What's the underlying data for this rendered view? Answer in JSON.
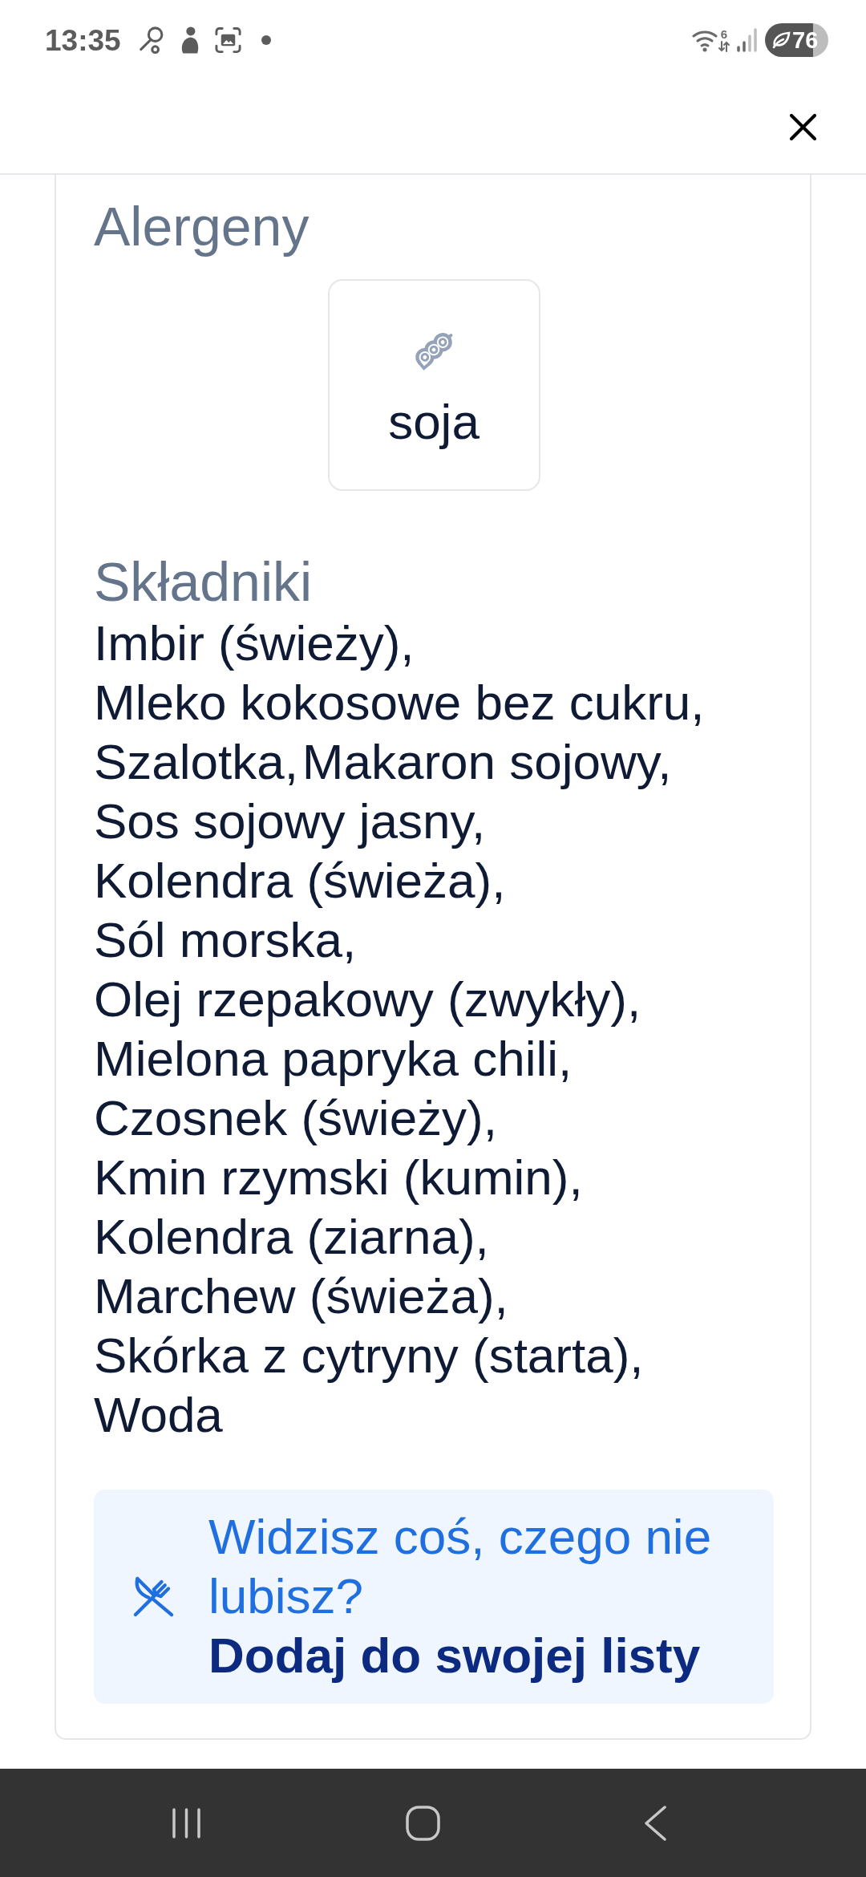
{
  "status_bar": {
    "time": "13:35",
    "wifi_label": "6",
    "battery": "76"
  },
  "allergens": {
    "title": "Alergeny",
    "items": [
      {
        "name": "soja"
      }
    ]
  },
  "ingredients": {
    "title": "Składniki",
    "items": [
      "Imbir (świeży),",
      "Mleko kokosowe bez cukru,",
      "Szalotka,",
      "Makaron sojowy,",
      "Sos sojowy jasny,",
      "Kolendra (świeża),",
      "Sól morska,",
      "Olej rzepakowy (zwykły),",
      "Mielona papryka chili,",
      "Czosnek (świeży),",
      "Kmin rzymski (kumin),",
      "Kolendra (ziarna),",
      "Marchew (świeża),",
      "Skórka z cytryny (starta),",
      "Woda"
    ]
  },
  "banner": {
    "question": "Widzisz coś, czego nie lubisz?",
    "link": "Dodaj do swojej listy"
  }
}
